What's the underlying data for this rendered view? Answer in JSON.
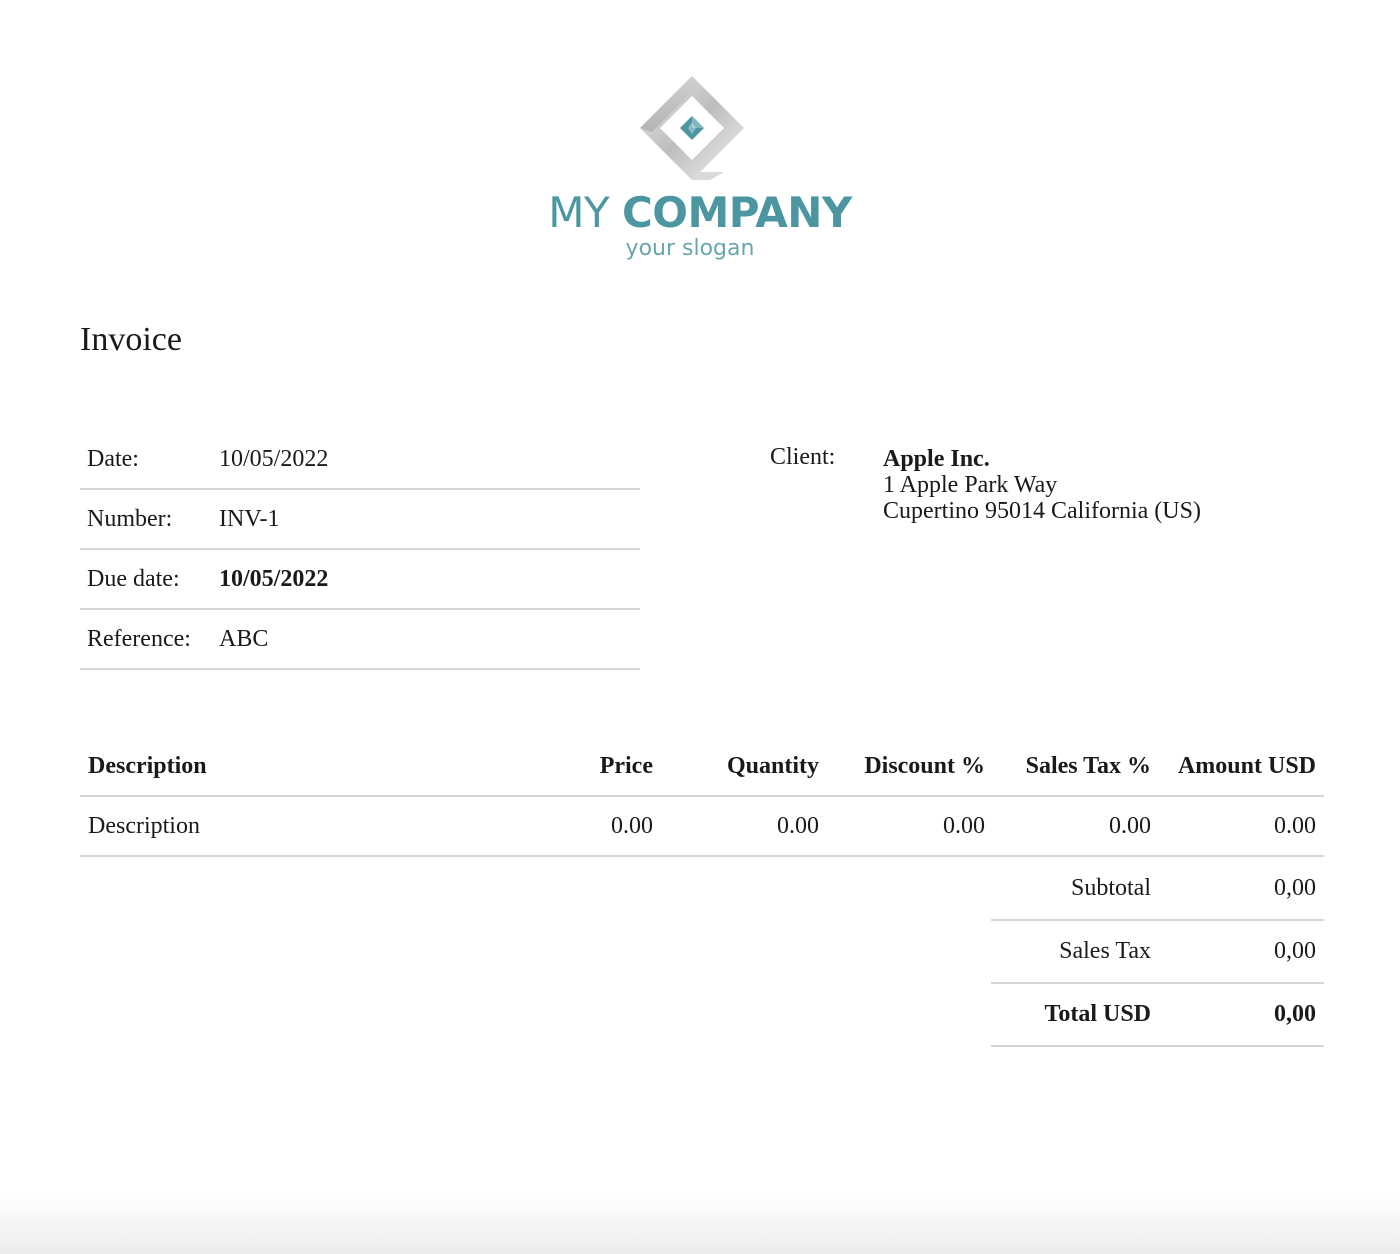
{
  "logo": {
    "name_light": "MY",
    "name_bold": "COMPANY",
    "slogan": "your slogan",
    "colors": {
      "teal": "#4b96a1",
      "silver": "#c8c8c8"
    }
  },
  "title": "Invoice",
  "meta": {
    "date_label": "Date:",
    "date_value": "10/05/2022",
    "number_label": "Number:",
    "number_value": "INV-1",
    "due_label": "Due date:",
    "due_value": "10/05/2022",
    "reference_label": "Reference:",
    "reference_value": "ABC"
  },
  "client": {
    "label": "Client:",
    "name": "Apple Inc.",
    "address_line1": "1 Apple Park Way",
    "address_line2": "Cupertino 95014 California (US)"
  },
  "items": {
    "headers": {
      "description": "Description",
      "price": "Price",
      "quantity": "Quantity",
      "discount": "Discount %",
      "sales_tax": "Sales Tax %",
      "amount": "Amount USD"
    },
    "rows": [
      {
        "description": "Description",
        "price": "0.00",
        "quantity": "0.00",
        "discount": "0.00",
        "sales_tax": "0.00",
        "amount": "0.00"
      }
    ]
  },
  "totals": {
    "subtotal_label": "Subtotal",
    "subtotal_value": "0,00",
    "tax_label": "Sales Tax",
    "tax_value": "0,00",
    "total_label": "Total USD",
    "total_value": "0,00"
  }
}
